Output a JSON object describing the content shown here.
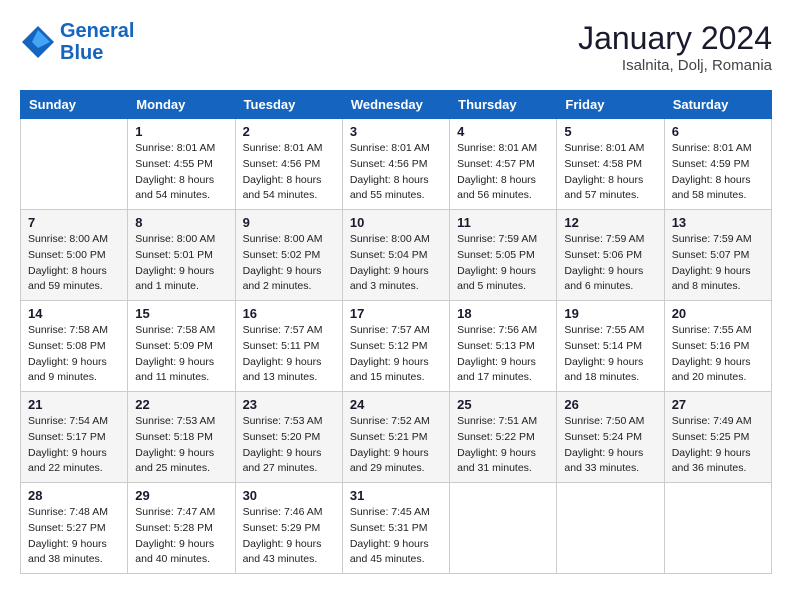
{
  "logo": {
    "line1": "General",
    "line2": "Blue"
  },
  "title": "January 2024",
  "location": "Isalnita, Dolj, Romania",
  "weekdays": [
    "Sunday",
    "Monday",
    "Tuesday",
    "Wednesday",
    "Thursday",
    "Friday",
    "Saturday"
  ],
  "weeks": [
    [
      null,
      {
        "day": "1",
        "sunrise": "8:01 AM",
        "sunset": "4:55 PM",
        "daylight": "8 hours and 54 minutes."
      },
      {
        "day": "2",
        "sunrise": "8:01 AM",
        "sunset": "4:56 PM",
        "daylight": "8 hours and 54 minutes."
      },
      {
        "day": "3",
        "sunrise": "8:01 AM",
        "sunset": "4:56 PM",
        "daylight": "8 hours and 55 minutes."
      },
      {
        "day": "4",
        "sunrise": "8:01 AM",
        "sunset": "4:57 PM",
        "daylight": "8 hours and 56 minutes."
      },
      {
        "day": "5",
        "sunrise": "8:01 AM",
        "sunset": "4:58 PM",
        "daylight": "8 hours and 57 minutes."
      },
      {
        "day": "6",
        "sunrise": "8:01 AM",
        "sunset": "4:59 PM",
        "daylight": "8 hours and 58 minutes."
      }
    ],
    [
      {
        "day": "7",
        "sunrise": "8:00 AM",
        "sunset": "5:00 PM",
        "daylight": "8 hours and 59 minutes."
      },
      {
        "day": "8",
        "sunrise": "8:00 AM",
        "sunset": "5:01 PM",
        "daylight": "9 hours and 1 minute."
      },
      {
        "day": "9",
        "sunrise": "8:00 AM",
        "sunset": "5:02 PM",
        "daylight": "9 hours and 2 minutes."
      },
      {
        "day": "10",
        "sunrise": "8:00 AM",
        "sunset": "5:04 PM",
        "daylight": "9 hours and 3 minutes."
      },
      {
        "day": "11",
        "sunrise": "7:59 AM",
        "sunset": "5:05 PM",
        "daylight": "9 hours and 5 minutes."
      },
      {
        "day": "12",
        "sunrise": "7:59 AM",
        "sunset": "5:06 PM",
        "daylight": "9 hours and 6 minutes."
      },
      {
        "day": "13",
        "sunrise": "7:59 AM",
        "sunset": "5:07 PM",
        "daylight": "9 hours and 8 minutes."
      }
    ],
    [
      {
        "day": "14",
        "sunrise": "7:58 AM",
        "sunset": "5:08 PM",
        "daylight": "9 hours and 9 minutes."
      },
      {
        "day": "15",
        "sunrise": "7:58 AM",
        "sunset": "5:09 PM",
        "daylight": "9 hours and 11 minutes."
      },
      {
        "day": "16",
        "sunrise": "7:57 AM",
        "sunset": "5:11 PM",
        "daylight": "9 hours and 13 minutes."
      },
      {
        "day": "17",
        "sunrise": "7:57 AM",
        "sunset": "5:12 PM",
        "daylight": "9 hours and 15 minutes."
      },
      {
        "day": "18",
        "sunrise": "7:56 AM",
        "sunset": "5:13 PM",
        "daylight": "9 hours and 17 minutes."
      },
      {
        "day": "19",
        "sunrise": "7:55 AM",
        "sunset": "5:14 PM",
        "daylight": "9 hours and 18 minutes."
      },
      {
        "day": "20",
        "sunrise": "7:55 AM",
        "sunset": "5:16 PM",
        "daylight": "9 hours and 20 minutes."
      }
    ],
    [
      {
        "day": "21",
        "sunrise": "7:54 AM",
        "sunset": "5:17 PM",
        "daylight": "9 hours and 22 minutes."
      },
      {
        "day": "22",
        "sunrise": "7:53 AM",
        "sunset": "5:18 PM",
        "daylight": "9 hours and 25 minutes."
      },
      {
        "day": "23",
        "sunrise": "7:53 AM",
        "sunset": "5:20 PM",
        "daylight": "9 hours and 27 minutes."
      },
      {
        "day": "24",
        "sunrise": "7:52 AM",
        "sunset": "5:21 PM",
        "daylight": "9 hours and 29 minutes."
      },
      {
        "day": "25",
        "sunrise": "7:51 AM",
        "sunset": "5:22 PM",
        "daylight": "9 hours and 31 minutes."
      },
      {
        "day": "26",
        "sunrise": "7:50 AM",
        "sunset": "5:24 PM",
        "daylight": "9 hours and 33 minutes."
      },
      {
        "day": "27",
        "sunrise": "7:49 AM",
        "sunset": "5:25 PM",
        "daylight": "9 hours and 36 minutes."
      }
    ],
    [
      {
        "day": "28",
        "sunrise": "7:48 AM",
        "sunset": "5:27 PM",
        "daylight": "9 hours and 38 minutes."
      },
      {
        "day": "29",
        "sunrise": "7:47 AM",
        "sunset": "5:28 PM",
        "daylight": "9 hours and 40 minutes."
      },
      {
        "day": "30",
        "sunrise": "7:46 AM",
        "sunset": "5:29 PM",
        "daylight": "9 hours and 43 minutes."
      },
      {
        "day": "31",
        "sunrise": "7:45 AM",
        "sunset": "5:31 PM",
        "daylight": "9 hours and 45 minutes."
      },
      null,
      null,
      null
    ]
  ],
  "labels": {
    "sunrise_prefix": "Sunrise: ",
    "sunset_prefix": "Sunset: ",
    "daylight_prefix": "Daylight: "
  }
}
